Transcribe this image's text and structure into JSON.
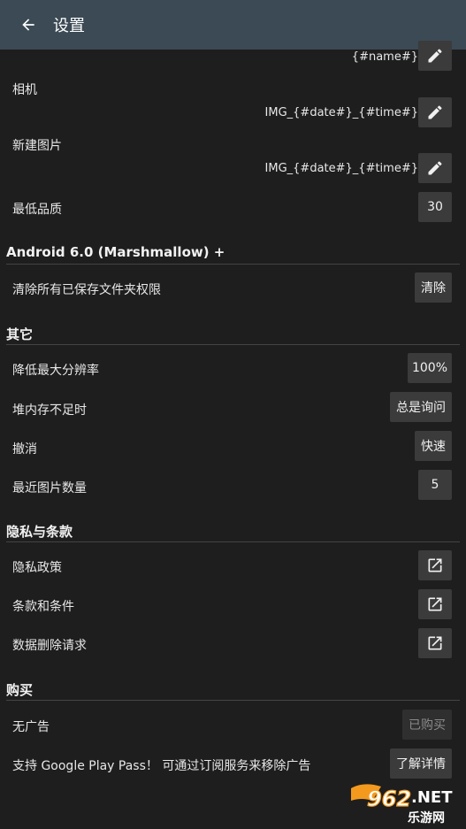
{
  "appbar": {
    "title": "设置"
  },
  "save_names": {
    "default_value": "{#name#}",
    "camera_label": "相机",
    "camera_value": "IMG_{#date#}_{#time#}",
    "new_image_label": "新建图片",
    "new_image_value": "IMG_{#date#}_{#time#}",
    "min_quality_label": "最低品质",
    "min_quality_value": "30"
  },
  "android6": {
    "title": "Android 6.0 (Marshmallow) +",
    "clear_label": "清除所有已保存文件夹权限",
    "clear_button": "清除"
  },
  "other": {
    "title": "其它",
    "reduce_res_label": "降低最大分辨率",
    "reduce_res_value": "100%",
    "low_memory_label": "堆内存不足时",
    "low_memory_value": "总是询问",
    "undo_label": "撤消",
    "undo_value": "快速",
    "recent_label": "最近图片数量",
    "recent_value": "5"
  },
  "privacy": {
    "title": "隐私与条款",
    "policy_label": "隐私政策",
    "terms_label": "条款和条件",
    "deletion_label": "数据删除请求"
  },
  "purchase": {
    "title": "购买",
    "no_ads_label": "无广告",
    "no_ads_button": "已购买",
    "play_pass_label": "支持 Google Play Pass！ 可通过订阅服务来移除广告",
    "play_pass_button": "了解详情"
  },
  "watermark": {
    "number": "962",
    "suffix": ".NET",
    "site": "乐游网"
  },
  "colors": {
    "appbar": "#3b4a55",
    "background": "#1e1e1e",
    "button": "#3b3b3b",
    "divider": "#444444",
    "watermark_orange": "#f39a1e"
  }
}
